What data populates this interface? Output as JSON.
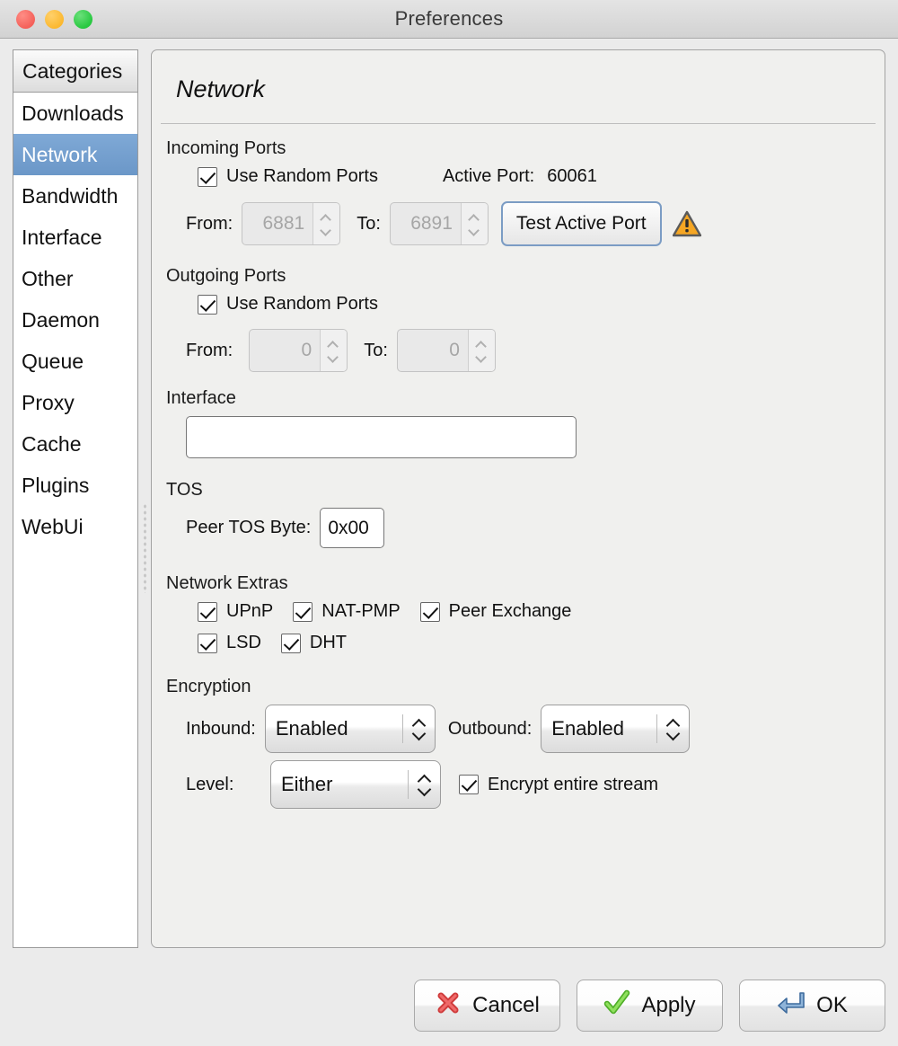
{
  "window": {
    "title": "Preferences",
    "controls": [
      "close",
      "minimize",
      "zoom"
    ]
  },
  "sidebar": {
    "header": "Categories",
    "items": [
      {
        "label": "Downloads",
        "selected": false
      },
      {
        "label": "Network",
        "selected": true
      },
      {
        "label": "Bandwidth",
        "selected": false
      },
      {
        "label": "Interface",
        "selected": false
      },
      {
        "label": "Other",
        "selected": false
      },
      {
        "label": "Daemon",
        "selected": false
      },
      {
        "label": "Queue",
        "selected": false
      },
      {
        "label": "Proxy",
        "selected": false
      },
      {
        "label": "Cache",
        "selected": false
      },
      {
        "label": "Plugins",
        "selected": false
      },
      {
        "label": "WebUi",
        "selected": false
      }
    ],
    "selected_color": "#6f9fd0"
  },
  "page": {
    "title": "Network",
    "incoming": {
      "group_label": "Incoming Ports",
      "random_label": "Use Random Ports",
      "random_checked": true,
      "active_port_label": "Active Port:",
      "active_port_value": "60061",
      "from_label": "From:",
      "from_value": "6881",
      "to_label": "To:",
      "to_value": "6891",
      "test_button": "Test Active Port",
      "warning_icon": "warning-triangle-icon"
    },
    "outgoing": {
      "group_label": "Outgoing Ports",
      "random_label": "Use Random Ports",
      "random_checked": true,
      "from_label": "From:",
      "from_value": "0",
      "to_label": "To:",
      "to_value": "0"
    },
    "interface": {
      "group_label": "Interface",
      "value": "",
      "placeholder": ""
    },
    "tos": {
      "group_label": "TOS",
      "field_label": "Peer TOS Byte:",
      "value": "0x00"
    },
    "extras": {
      "group_label": "Network Extras",
      "row1": [
        {
          "label": "UPnP",
          "checked": true
        },
        {
          "label": "NAT-PMP",
          "checked": true
        },
        {
          "label": "Peer Exchange",
          "checked": true
        }
      ],
      "row2": [
        {
          "label": "LSD",
          "checked": true
        },
        {
          "label": "DHT",
          "checked": true
        }
      ]
    },
    "encryption": {
      "group_label": "Encryption",
      "inbound_label": "Inbound:",
      "inbound_value": "Enabled",
      "outbound_label": "Outbound:",
      "outbound_value": "Enabled",
      "level_label": "Level:",
      "level_value": "Either",
      "encrypt_stream_label": "Encrypt entire stream",
      "encrypt_stream_checked": true
    }
  },
  "footer": {
    "cancel": "Cancel",
    "apply": "Apply",
    "ok": "OK",
    "cancel_icon": "red-x-icon",
    "apply_icon": "green-check-icon",
    "ok_icon": "blue-enter-arrow-icon"
  }
}
